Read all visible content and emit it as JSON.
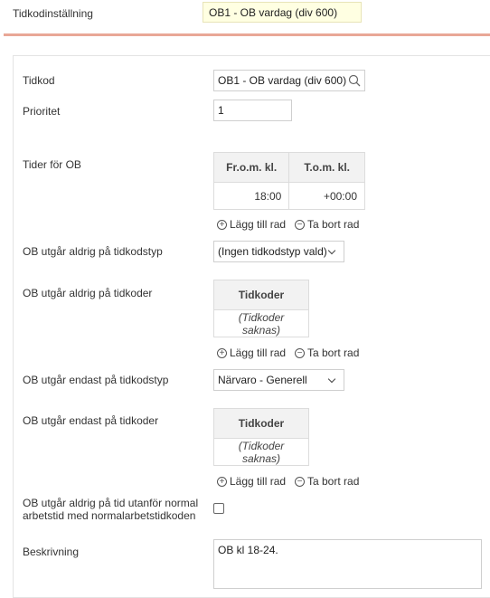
{
  "header": {
    "label": "Tidkodinställning",
    "value": "OB1 - OB vardag (div 600)"
  },
  "form": {
    "timecode": {
      "label": "Tidkod",
      "value": "OB1 - OB vardag (div 600)"
    },
    "priority": {
      "label": "Prioritet",
      "value": "1"
    },
    "times": {
      "label": "Tider för OB",
      "col_from": "Fr.o.m. kl.",
      "col_to": "T.o.m. kl.",
      "rows": [
        {
          "from": "18:00",
          "to": "+00:00"
        }
      ]
    },
    "never_type": {
      "label": "OB utgår aldrig på tidkodstyp",
      "value": "(Ingen tidkodstyp vald)"
    },
    "never_codes": {
      "label": "OB utgår aldrig på tidkoder",
      "header": "Tidkoder",
      "empty": "(Tidkoder saknas)"
    },
    "only_type": {
      "label": "OB utgår endast på tidkodstyp",
      "value": "Närvaro - Generell"
    },
    "only_codes": {
      "label": "OB utgår endast på tidkoder",
      "header": "Tidkoder",
      "empty": "(Tidkoder saknas)"
    },
    "outside": {
      "label_line1": "OB utgår aldrig på tid utanför normal",
      "label_line2": "arbetstid med normalarbetstidkoden",
      "checked": false
    },
    "description": {
      "label": "Beskrivning",
      "value": "OB kl 18-24."
    },
    "add_row": "Lägg till rad",
    "remove_row": "Ta bort rad"
  },
  "colors": {
    "accent_line": "#e9a796",
    "highlight_field": "#ffffe2"
  }
}
